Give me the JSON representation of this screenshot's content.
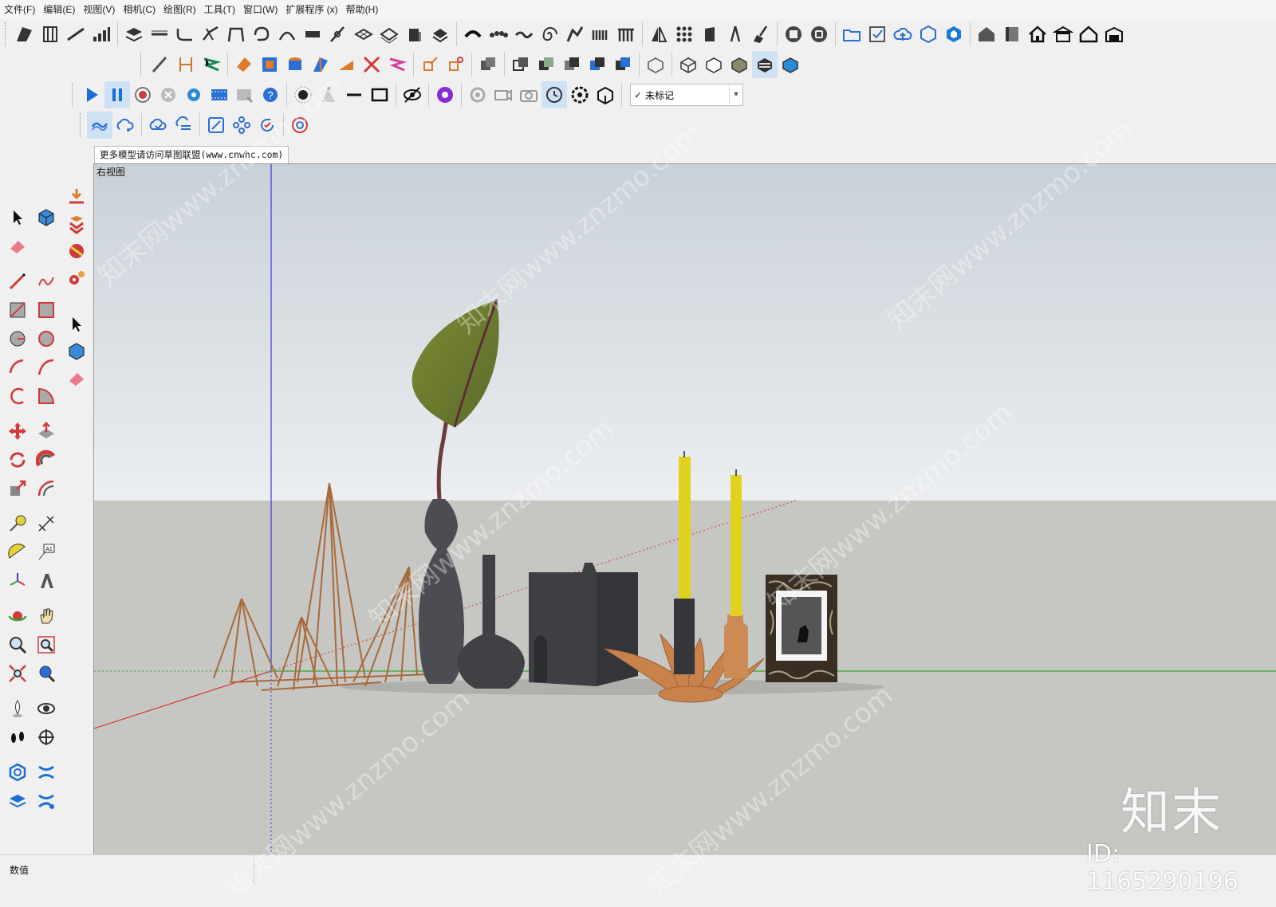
{
  "menu": [
    "文件(F)",
    "编辑(E)",
    "视图(V)",
    "相机(C)",
    "绘图(R)",
    "工具(T)",
    "窗口(W)",
    "扩展程序 (x)",
    "帮助(H)"
  ],
  "tag_dropdown": {
    "value": "未标记",
    "check": "✓"
  },
  "model_tab": "更多模型请访问草图联盟(www.cnwhc.com)",
  "view_label": "右视图",
  "status_label": "数值",
  "watermark": {
    "logo": "知末",
    "id": "ID: 1165290196",
    "tiled": "知末网www.znzmo.com"
  },
  "colors": {
    "sky_top": "#c9d1d8",
    "sky_bottom": "#eceef0",
    "ground": "#c6c6c3",
    "axis_red": "#d23a3a",
    "axis_green": "#3aa33a",
    "axis_blue": "#3a3ad2",
    "accent_blue": "#2a6fd6"
  }
}
